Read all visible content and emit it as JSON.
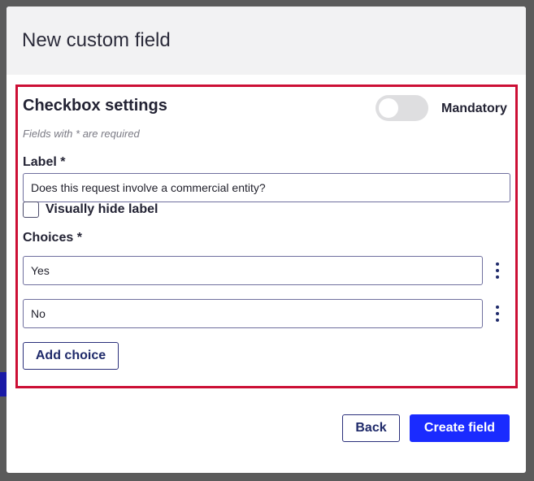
{
  "dialog": {
    "title": "New custom field"
  },
  "settings": {
    "title": "Checkbox settings",
    "mandatory_label": "Mandatory",
    "mandatory_on": false,
    "required_note": "Fields with * are required",
    "label_field": {
      "label": "Label *",
      "value": "Does this request involve a commercial entity?"
    },
    "hide_label_checkbox": {
      "label": "Visually hide label",
      "checked": false
    },
    "choices": {
      "label": "Choices *",
      "items": [
        {
          "value": "Yes"
        },
        {
          "value": "No"
        }
      ],
      "add_label": "Add choice"
    }
  },
  "footer": {
    "back_label": "Back",
    "create_label": "Create field"
  },
  "colors": {
    "highlight_border": "#cc0f35",
    "primary": "#1a2bff",
    "header_bg": "#f2f2f3"
  }
}
